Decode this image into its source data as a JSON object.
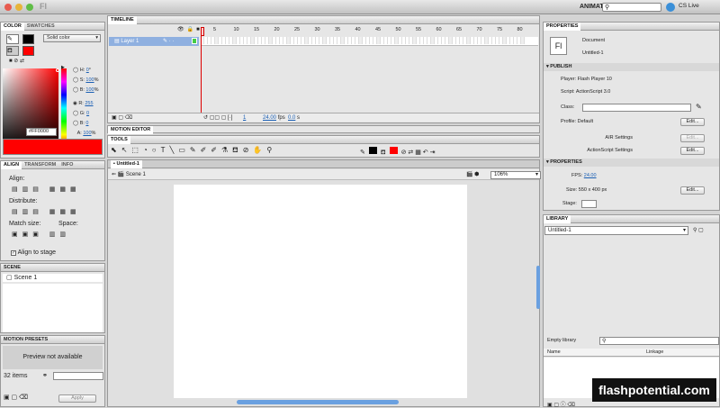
{
  "app": {
    "logo": "Fl",
    "workspace": "ANIMATOR",
    "search_placeholder": "",
    "cs_live": "CS Live"
  },
  "color_panel": {
    "tabs": [
      "COLOR",
      "SWATCHES"
    ],
    "fill_type": "Solid color",
    "h": "0",
    "h_unit": "°",
    "s": "100",
    "s_unit": "%",
    "b": "100",
    "b_unit": "%",
    "r": "255",
    "g": "0",
    "b2": "0",
    "alpha": "100",
    "alpha_unit": "%",
    "hex": "FF0000",
    "labels": {
      "h": "H:",
      "s": "S:",
      "b": "B:",
      "r": "R:",
      "g": "G:",
      "b2": "B:",
      "a": "A:"
    },
    "current_color": "#ff0000"
  },
  "align_panel": {
    "tabs": [
      "ALIGN",
      "TRANSFORM",
      "INFO"
    ],
    "align_label": "Align:",
    "distribute_label": "Distribute:",
    "match_label": "Match size:",
    "space_label": "Space:",
    "stage_label": "Align to stage"
  },
  "scene_panel": {
    "title": "SCENE",
    "scene": "Scene 1"
  },
  "motion_presets": {
    "title": "MOTION PRESETS",
    "preview": "Preview not available",
    "count": "32 items",
    "apply": "Apply"
  },
  "timeline": {
    "title": "TIMELINE",
    "layer": "Layer 1",
    "frame_numbers": [
      "5",
      "10",
      "15",
      "20",
      "25",
      "30",
      "35",
      "40",
      "45",
      "50",
      "55",
      "60",
      "65",
      "70",
      "75",
      "80"
    ],
    "current_frame": "1",
    "fps": "24.00",
    "fps_unit": "fps",
    "time": "0.0",
    "time_unit": "s"
  },
  "motion_editor": {
    "title": "MOTION EDITOR"
  },
  "tools": {
    "title": "TOOLS"
  },
  "document": {
    "tab": "Untitled-1",
    "scene": "Scene 1",
    "zoom": "106%"
  },
  "properties": {
    "title": "PROPERTIES",
    "doc_type": "Document",
    "doc_name": "Untitled-1",
    "publish_header": "PUBLISH",
    "player_label": "Player:",
    "player": "Flash Player 10",
    "script_label": "Script:",
    "script": "ActionScript 3.0",
    "class_label": "Class:",
    "profile_label": "Profile:",
    "profile": "Default",
    "edit": "Edit...",
    "air_label": "AIR Settings",
    "as_label": "ActionScript Settings",
    "props_header": "PROPERTIES",
    "fps_label": "FPS:",
    "fps": "24.00",
    "size_label": "Size:",
    "size": "550 x 400 px",
    "stage_label": "Stage:"
  },
  "library": {
    "title": "LIBRARY",
    "doc": "Untitled-1",
    "empty": "Empty library",
    "col_name": "Name",
    "col_linkage": "Linkage"
  },
  "watermark": "flashpotential.com"
}
